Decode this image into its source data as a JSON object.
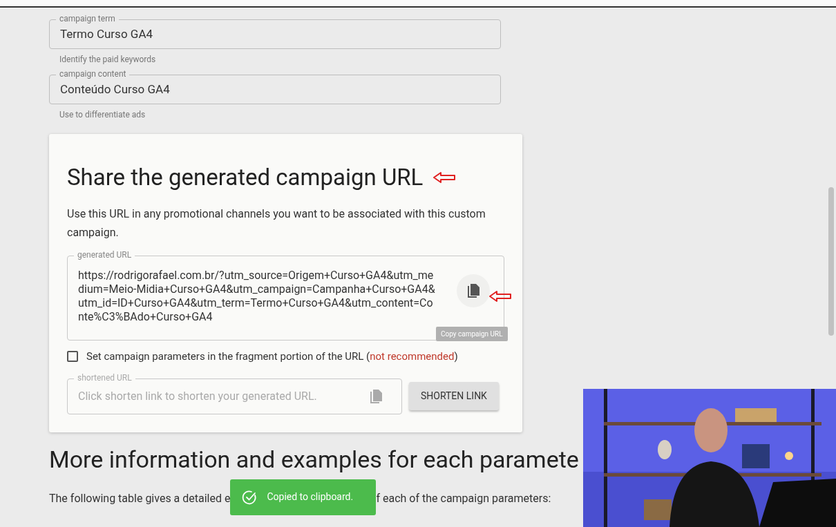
{
  "fields": [
    {
      "label": "campaign term",
      "value": "Termo Curso GA4",
      "helper": "Identify the paid keywords"
    },
    {
      "label": "campaign content",
      "value": "Conteúdo Curso GA4",
      "helper": "Use to differentiate ads"
    }
  ],
  "share_card": {
    "title": "Share the generated campaign URL",
    "description": "Use this URL in any promotional channels you want to be associated with this custom campaign.",
    "generated_url": {
      "label": "generated URL",
      "value": "https://rodrigorafael.com.br/?utm_source=Origem+Curso+GA4&utm_medium=Meio-Midia+Curso+GA4&utm_campaign=Campanha+Curso+GA4&utm_id=ID+Curso+GA4&utm_term=Termo+Curso+GA4&utm_content=Conte%C3%BAdo+Curso+GA4",
      "tooltip": "Copy campaign URL"
    },
    "fragment_checkbox": {
      "label": "Set campaign parameters in the fragment portion of the URL (",
      "note": "not recommended",
      "label_end": ")",
      "checked": false
    },
    "shortened_url": {
      "label": "shortened URL",
      "placeholder": "Click shorten link to shorten your generated URL."
    },
    "shorten_button": "SHORTEN LINK"
  },
  "section": {
    "heading": "More information and examples for each paramete",
    "text_before": "The following table gives a detailed e",
    "text_after": "f each of the campaign parameters:"
  },
  "toast": {
    "message": "Copied to clipboard."
  }
}
